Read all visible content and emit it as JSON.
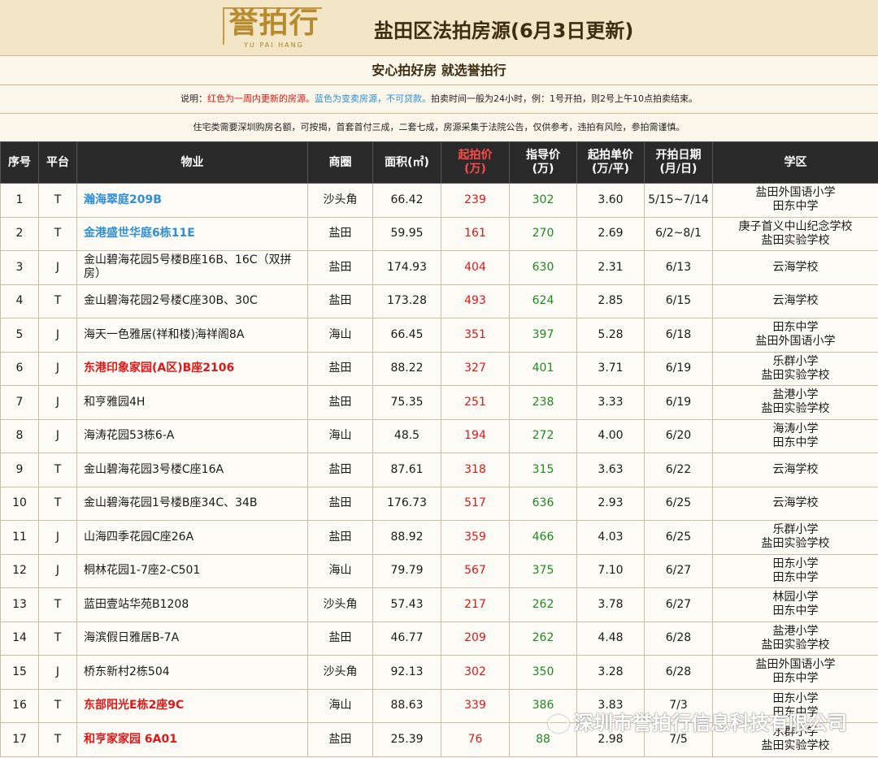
{
  "header": {
    "logo_text": "誉拍行",
    "logo_sub": "YU PAI HANG",
    "title": "盐田区法拍房源(6月3日更新)"
  },
  "slogan": "安心拍好房 就选誉拍行",
  "note1": {
    "prefix": "说明：",
    "red": "红色为一周内更新的房源。",
    "blue": "蓝色为变卖房源，不可贷款。",
    "rest": "拍卖时间一般为24小时，例：1号开拍，则2号上午10点拍卖结束。"
  },
  "note2": "住宅类需要深圳购房名额，可按揭，首套首付三成，二套七成，房源采集于法院公告，仅供参考，违拍有风险，参拍需谨慎。",
  "columns": {
    "no": "序号",
    "platform": "平台",
    "property": "物业",
    "district": "商圈",
    "area": "面积(㎡)",
    "start_price_1": "起拍价",
    "start_price_2": "(万)",
    "guide_price_1": "指导价",
    "guide_price_2": "(万)",
    "unit_price_1": "起拍单价",
    "unit_price_2": "(万/平)",
    "date_1": "开拍日期",
    "date_2": "(月/日)",
    "school": "学区"
  },
  "rows": [
    {
      "no": "1",
      "platform": "T",
      "property": "瀚海翠庭209B",
      "style": "blue",
      "district": "沙头角",
      "area": "66.42",
      "start": "239",
      "guide": "302",
      "unit": "3.60",
      "date": "5/15~7/14",
      "school1": "盐田外国语小学",
      "school2": "田东中学"
    },
    {
      "no": "2",
      "platform": "T",
      "property": "金港盛世华庭6栋11E",
      "style": "blue",
      "district": "盐田",
      "area": "59.95",
      "start": "161",
      "guide": "270",
      "unit": "2.69",
      "date": "6/2~8/1",
      "school1": "庚子首义中山纪念学校",
      "school2": "盐田实验学校"
    },
    {
      "no": "3",
      "platform": "J",
      "property": "金山碧海花园5号楼B座16B、16C（双拼房）",
      "style": "",
      "district": "盐田",
      "area": "174.93",
      "start": "404",
      "guide": "630",
      "unit": "2.31",
      "date": "6/13",
      "school1": "云海学校",
      "school2": ""
    },
    {
      "no": "4",
      "platform": "T",
      "property": "金山碧海花园2号楼C座30B、30C",
      "style": "",
      "district": "盐田",
      "area": "173.28",
      "start": "493",
      "guide": "624",
      "unit": "2.85",
      "date": "6/15",
      "school1": "云海学校",
      "school2": ""
    },
    {
      "no": "5",
      "platform": "J",
      "property": "海天一色雅居(祥和楼)海祥阁8A",
      "style": "",
      "district": "海山",
      "area": "66.45",
      "start": "351",
      "guide": "397",
      "unit": "5.28",
      "date": "6/18",
      "school1": "田东中学",
      "school2": "盐田外国语小学"
    },
    {
      "no": "6",
      "platform": "J",
      "property": "东港印象家园(A区)B座2106",
      "style": "red",
      "district": "盐田",
      "area": "88.22",
      "start": "327",
      "guide": "401",
      "unit": "3.71",
      "date": "6/19",
      "school1": "乐群小学",
      "school2": "盐田实验学校"
    },
    {
      "no": "7",
      "platform": "J",
      "property": "和亨雅园4H",
      "style": "",
      "district": "盐田",
      "area": "75.35",
      "start": "251",
      "guide": "238",
      "unit": "3.33",
      "date": "6/19",
      "school1": "盐港小学",
      "school2": "盐田实验学校"
    },
    {
      "no": "8",
      "platform": "J",
      "property": "海涛花园53栋6-A",
      "style": "",
      "district": "海山",
      "area": "48.5",
      "start": "194",
      "guide": "272",
      "unit": "4.00",
      "date": "6/20",
      "school1": "海涛小学",
      "school2": "田东中学"
    },
    {
      "no": "9",
      "platform": "T",
      "property": "金山碧海花园3号楼C座16A",
      "style": "",
      "district": "盐田",
      "area": "87.61",
      "start": "318",
      "guide": "315",
      "unit": "3.63",
      "date": "6/22",
      "school1": "云海学校",
      "school2": ""
    },
    {
      "no": "10",
      "platform": "T",
      "property": "金山碧海花园1号楼B座34C、34B",
      "style": "",
      "district": "盐田",
      "area": "176.73",
      "start": "517",
      "guide": "636",
      "unit": "2.93",
      "date": "6/25",
      "school1": "云海学校",
      "school2": ""
    },
    {
      "no": "11",
      "platform": "J",
      "property": "山海四季花园C座26A",
      "style": "",
      "district": "盐田",
      "area": "88.92",
      "start": "359",
      "guide": "466",
      "unit": "4.03",
      "date": "6/25",
      "school1": "乐群小学",
      "school2": "盐田实验学校"
    },
    {
      "no": "12",
      "platform": "J",
      "property": "桐林花园1-7座2-C501",
      "style": "",
      "district": "海山",
      "area": "79.79",
      "start": "567",
      "guide": "375",
      "unit": "7.10",
      "date": "6/27",
      "school1": "田东小学",
      "school2": "田东中学"
    },
    {
      "no": "13",
      "platform": "T",
      "property": "蓝田壹站华苑B1208",
      "style": "",
      "district": "沙头角",
      "area": "57.43",
      "start": "217",
      "guide": "262",
      "unit": "3.78",
      "date": "6/27",
      "school1": "林园小学",
      "school2": "田东中学"
    },
    {
      "no": "14",
      "platform": "T",
      "property": "海滨假日雅居B-7A",
      "style": "",
      "district": "盐田",
      "area": "46.77",
      "start": "209",
      "guide": "262",
      "unit": "4.48",
      "date": "6/28",
      "school1": "盐港小学",
      "school2": "盐田实验学校"
    },
    {
      "no": "15",
      "platform": "J",
      "property": "桥东新村2栋504",
      "style": "",
      "district": "沙头角",
      "area": "92.13",
      "start": "302",
      "guide": "350",
      "unit": "3.28",
      "date": "6/28",
      "school1": "盐田外国语小学",
      "school2": "田东中学"
    },
    {
      "no": "16",
      "platform": "T",
      "property": "东部阳光E栋2座9C",
      "style": "red",
      "district": "海山",
      "area": "88.63",
      "start": "339",
      "guide": "386",
      "unit": "3.83",
      "date": "7/3",
      "school1": "田东小学",
      "school2": "田东中学"
    },
    {
      "no": "17",
      "platform": "T",
      "property": "和亨家家园 6A01",
      "style": "red",
      "district": "盐田",
      "area": "25.39",
      "start": "76",
      "guide": "88",
      "unit": "2.98",
      "date": "7/5",
      "school1": "乐群小学",
      "school2": "盐田实验学校"
    }
  ],
  "watermark": "深圳市誉拍行信息科技有限公司",
  "colors": {
    "red": "#e01717",
    "blue": "#2f8ed6",
    "green": "#1f8a1f",
    "header_bg": "#2a2a2a"
  }
}
